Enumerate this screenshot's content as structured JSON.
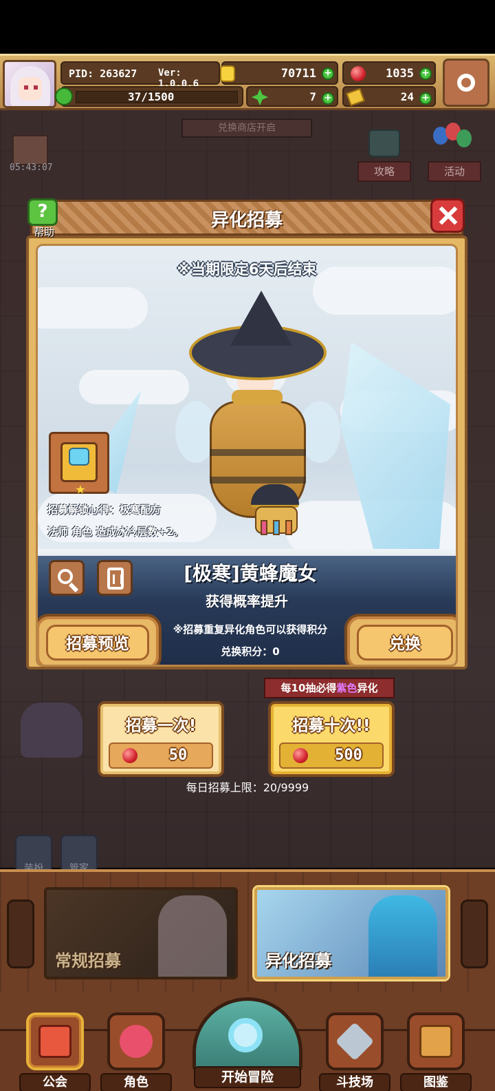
{
  "player": {
    "pid": "PID: 263627",
    "version": "Ver: 1.0.0.6",
    "gold": "70711",
    "gems": "1035",
    "stamina": "37/1500",
    "clover": "7",
    "tickets": "24"
  },
  "scene": {
    "shop_banner": "兑换商店开启",
    "timer": "05:43:07",
    "guide_label": "攻略",
    "event_label": "活动",
    "dress_label": "装扮",
    "butler_label": "管家"
  },
  "modal": {
    "title": "异化招募",
    "help_label": "帮助",
    "period_notice": "※当期限定6天后结束",
    "unlock_title": "招募解锁心得：极寒配方",
    "unlock_desc": "法师 角色 造成冰冷层数+2。",
    "character_name": "[极寒]黄蜂魔女",
    "rate_up": "获得概率提升",
    "points_note": "※招募重复异化角色可以获得积分",
    "points_text": "兑换积分：0",
    "preview_button": "招募预览",
    "exchange_button": "兑换"
  },
  "recruit": {
    "guarantee_prefix": "每10抽必得",
    "guarantee_highlight": "紫色",
    "guarantee_suffix": "异化",
    "once_label": "招募一次!",
    "once_cost": "50",
    "ten_label": "招募十次!!",
    "ten_cost": "500",
    "daily_limit": "每日招募上限：20/9999"
  },
  "pools": {
    "normal": "常规招募",
    "alt": "异化招募"
  },
  "nav": {
    "guild": "公会",
    "character": "角色",
    "adventure": "开始冒险",
    "arena": "斗技场",
    "codex": "图鉴"
  },
  "colors": {
    "accent_wood": "#e7b866",
    "frame_brown": "#7b4a20",
    "gem_red": "#d2232e",
    "plus_green": "#48c43e",
    "purple_text": "#e07cff"
  },
  "icons": [
    "gold-coin-icon",
    "gem-icon",
    "plus-icon",
    "stamina-icon",
    "clover-icon",
    "ticket-icon",
    "gear-icon",
    "help-icon",
    "close-icon",
    "zoom-icon",
    "list-icon"
  ]
}
